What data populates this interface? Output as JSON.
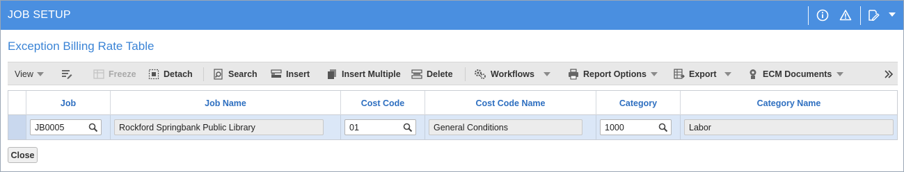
{
  "header": {
    "title": "JOB SETUP",
    "bg_color": "#4a8fe0",
    "icons": [
      "info-icon",
      "warning-icon",
      "edit-note-icon",
      "caret-down-icon"
    ]
  },
  "section": {
    "title": "Exception Billing Rate Table"
  },
  "toolbar": {
    "view_label": "View",
    "freeze_label": "Freeze",
    "detach_label": "Detach",
    "search_label": "Search",
    "insert_label": "Insert",
    "insert_multiple_label": "Insert Multiple",
    "delete_label": "Delete",
    "workflows_label": "Workflows",
    "report_options_label": "Report Options",
    "export_label": "Export",
    "ecm_documents_label": "ECM Documents",
    "more_icon": "double-chevron-right-icon"
  },
  "grid": {
    "columns": [
      "Job",
      "Job Name",
      "Cost Code",
      "Cost Code Name",
      "Category",
      "Category Name"
    ],
    "rows": [
      {
        "job": "JB0005",
        "job_name": "Rockford Springbank Public Library",
        "cost_code": "01",
        "cost_code_name": "General Conditions",
        "category": "1000",
        "category_name": "Labor"
      }
    ]
  },
  "footer": {
    "close_label": "Close"
  }
}
